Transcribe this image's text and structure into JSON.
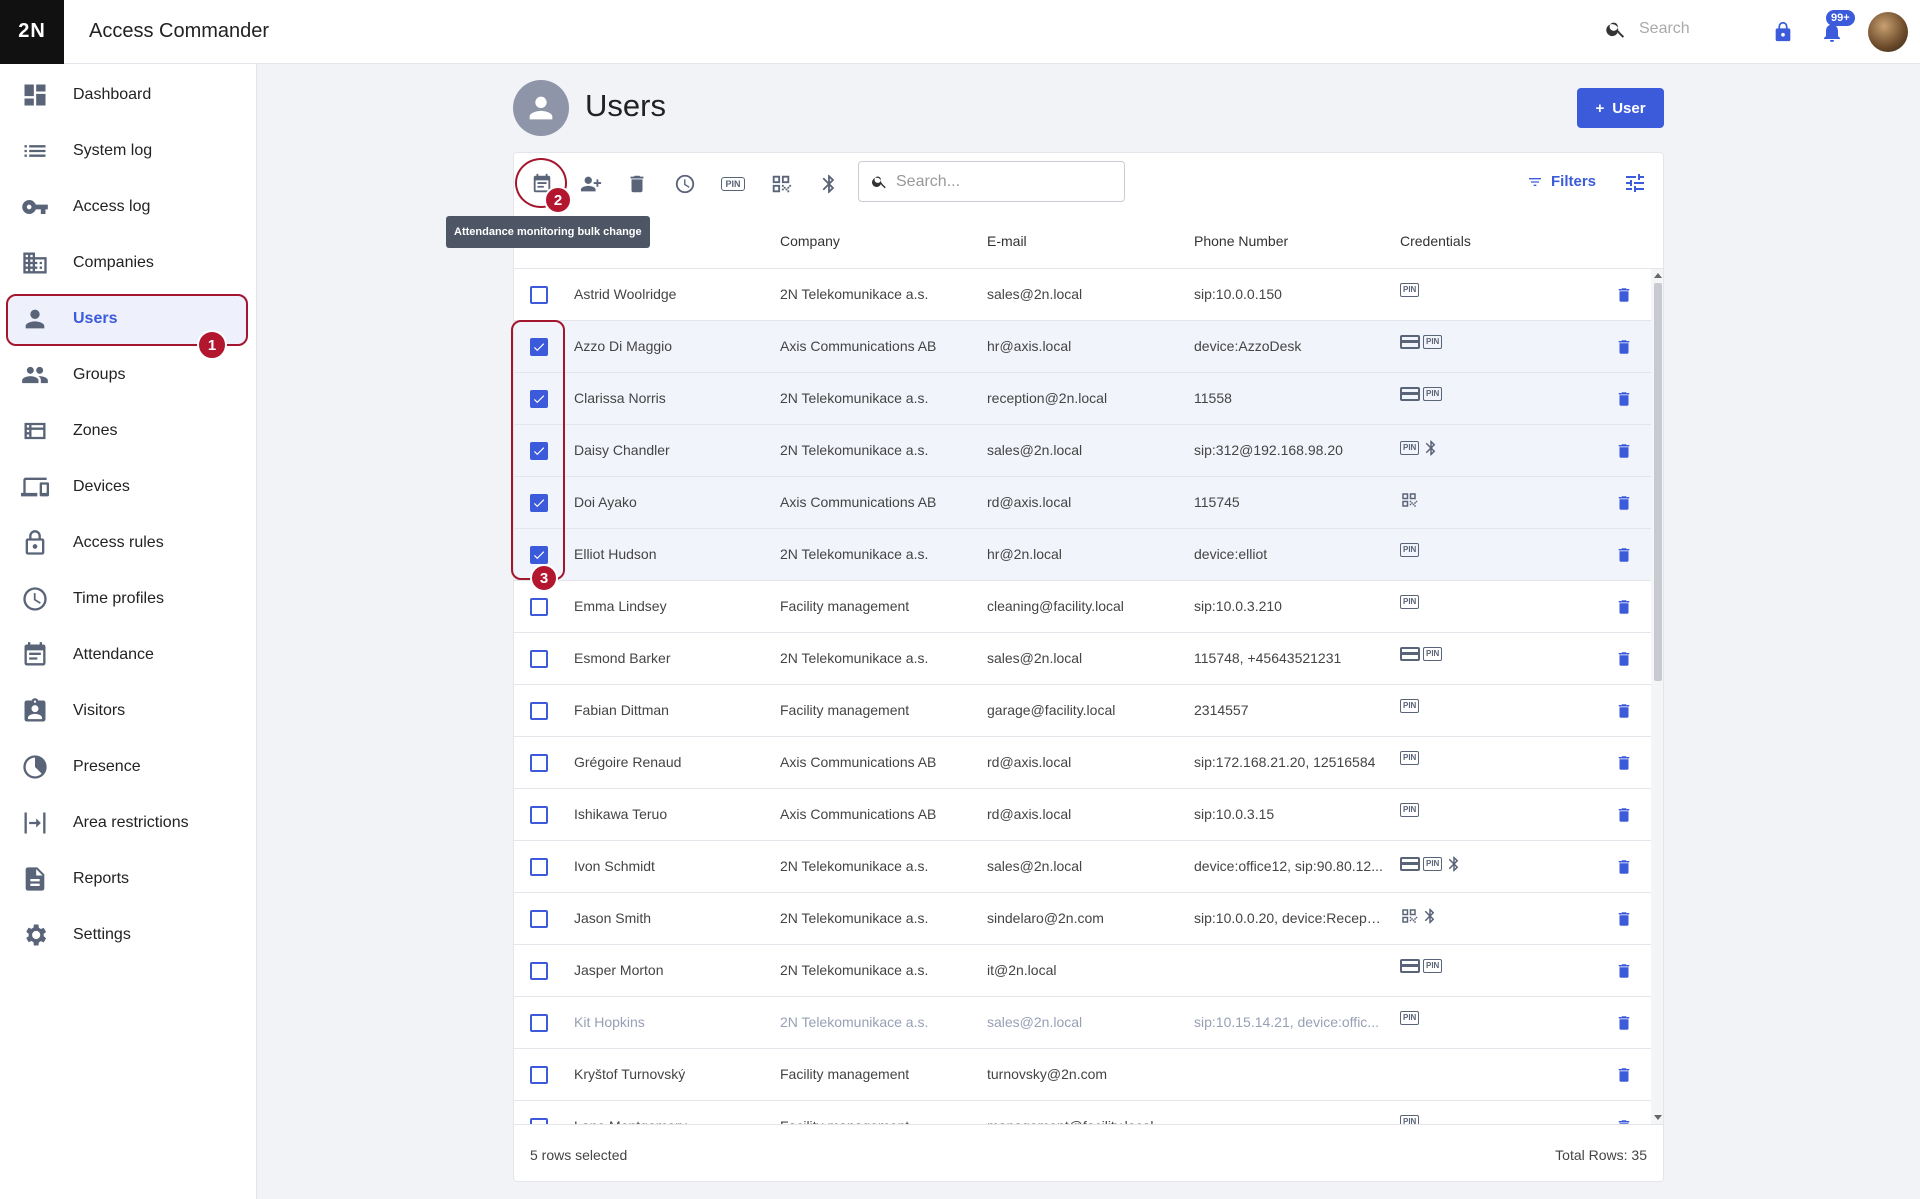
{
  "app": {
    "logo": "2N",
    "title": "Access Commander"
  },
  "topbar": {
    "search_placeholder": "Search",
    "notification_badge": "99+"
  },
  "sidebar": {
    "items": [
      {
        "label": "Dashboard",
        "icon": "dashboard-icon"
      },
      {
        "label": "System log",
        "icon": "list-icon"
      },
      {
        "label": "Access log",
        "icon": "key-icon"
      },
      {
        "label": "Companies",
        "icon": "building-icon"
      },
      {
        "label": "Users",
        "icon": "person-icon",
        "active": true
      },
      {
        "label": "Groups",
        "icon": "group-icon"
      },
      {
        "label": "Zones",
        "icon": "zones-icon"
      },
      {
        "label": "Devices",
        "icon": "devices-icon"
      },
      {
        "label": "Access rules",
        "icon": "lock-icon"
      },
      {
        "label": "Time profiles",
        "icon": "clock-icon"
      },
      {
        "label": "Attendance",
        "icon": "calendar-icon"
      },
      {
        "label": "Visitors",
        "icon": "badge-icon"
      },
      {
        "label": "Presence",
        "icon": "presence-icon"
      },
      {
        "label": "Area restrictions",
        "icon": "area-icon"
      },
      {
        "label": "Reports",
        "icon": "document-icon"
      },
      {
        "label": "Settings",
        "icon": "gear-icon"
      }
    ]
  },
  "page": {
    "title": "Users",
    "add_button": "User"
  },
  "toolbar": {
    "search_placeholder": "Search...",
    "filters_label": "Filters",
    "pin_label": "PIN",
    "tooltip": "Attendance monitoring bulk change"
  },
  "steps": [
    "1",
    "2",
    "3"
  ],
  "table": {
    "columns": [
      "Company",
      "E-mail",
      "Phone Number",
      "Credentials"
    ],
    "rows": [
      {
        "name": "Astrid Woolridge",
        "company": "2N Telekomunikace a.s.",
        "email": "sales@2n.local",
        "phone": "sip:10.0.0.150",
        "creds": [
          "pin"
        ],
        "selected": false
      },
      {
        "name": "Azzo Di Maggio",
        "company": "Axis Communications AB",
        "email": "hr@axis.local",
        "phone": "device:AzzoDesk",
        "creds": [
          "card",
          "pin"
        ],
        "selected": true
      },
      {
        "name": "Clarissa Norris",
        "company": "2N Telekomunikace a.s.",
        "email": "reception@2n.local",
        "phone": "11558",
        "creds": [
          "card",
          "pin"
        ],
        "selected": true
      },
      {
        "name": "Daisy Chandler",
        "company": "2N Telekomunikace a.s.",
        "email": "sales@2n.local",
        "phone": "sip:312@192.168.98.20",
        "creds": [
          "pin",
          "bt"
        ],
        "selected": true
      },
      {
        "name": "Doi Ayako",
        "company": "Axis Communications AB",
        "email": "rd@axis.local",
        "phone": "115745",
        "creds": [
          "qr"
        ],
        "selected": true
      },
      {
        "name": "Elliot Hudson",
        "company": "2N Telekomunikace a.s.",
        "email": "hr@2n.local",
        "phone": "device:elliot",
        "creds": [
          "pin"
        ],
        "selected": true
      },
      {
        "name": "Emma Lindsey",
        "company": "Facility management",
        "email": "cleaning@facility.local",
        "phone": "sip:10.0.3.210",
        "creds": [
          "pin"
        ],
        "selected": false
      },
      {
        "name": "Esmond Barker",
        "company": "2N Telekomunikace a.s.",
        "email": "sales@2n.local",
        "phone": "115748, +45643521231",
        "creds": [
          "card",
          "pin"
        ],
        "selected": false
      },
      {
        "name": "Fabian Dittman",
        "company": "Facility management",
        "email": "garage@facility.local",
        "phone": "2314557",
        "creds": [
          "pin"
        ],
        "selected": false
      },
      {
        "name": "Grégoire Renaud",
        "company": "Axis Communications AB",
        "email": "rd@axis.local",
        "phone": "sip:172.168.21.20, 12516584",
        "creds": [
          "pin"
        ],
        "selected": false
      },
      {
        "name": "Ishikawa Teruo",
        "company": "Axis Communications AB",
        "email": "rd@axis.local",
        "phone": "sip:10.0.3.15",
        "creds": [
          "pin"
        ],
        "selected": false
      },
      {
        "name": "Ivon Schmidt",
        "company": "2N Telekomunikace a.s.",
        "email": "sales@2n.local",
        "phone": "device:office12, sip:90.80.12...",
        "creds": [
          "card",
          "pin",
          "bt"
        ],
        "selected": false
      },
      {
        "name": "Jason Smith",
        "company": "2N Telekomunikace a.s.",
        "email": "sindelaro@2n.com",
        "phone": "sip:10.0.0.20, device:Recepti...",
        "creds": [
          "qr",
          "bt"
        ],
        "selected": false
      },
      {
        "name": "Jasper Morton",
        "company": "2N Telekomunikace a.s.",
        "email": "it@2n.local",
        "phone": "",
        "creds": [
          "card",
          "pin"
        ],
        "selected": false
      },
      {
        "name": "Kit Hopkins",
        "company": "2N Telekomunikace a.s.",
        "email": "sales@2n.local",
        "phone": "sip:10.15.14.21, device:offic...",
        "creds": [
          "pin"
        ],
        "selected": false,
        "dim": true
      },
      {
        "name": "Kryštof Turnovský",
        "company": "Facility management",
        "email": "turnovsky@2n.com",
        "phone": "",
        "creds": [],
        "selected": false
      },
      {
        "name": "Lane Montgomery",
        "company": "Facility management",
        "email": "management@facility.local",
        "phone": "",
        "creds": [
          "pin"
        ],
        "selected": false
      }
    ]
  },
  "footer": {
    "selected": "5 rows selected",
    "total": "Total Rows: 35"
  }
}
